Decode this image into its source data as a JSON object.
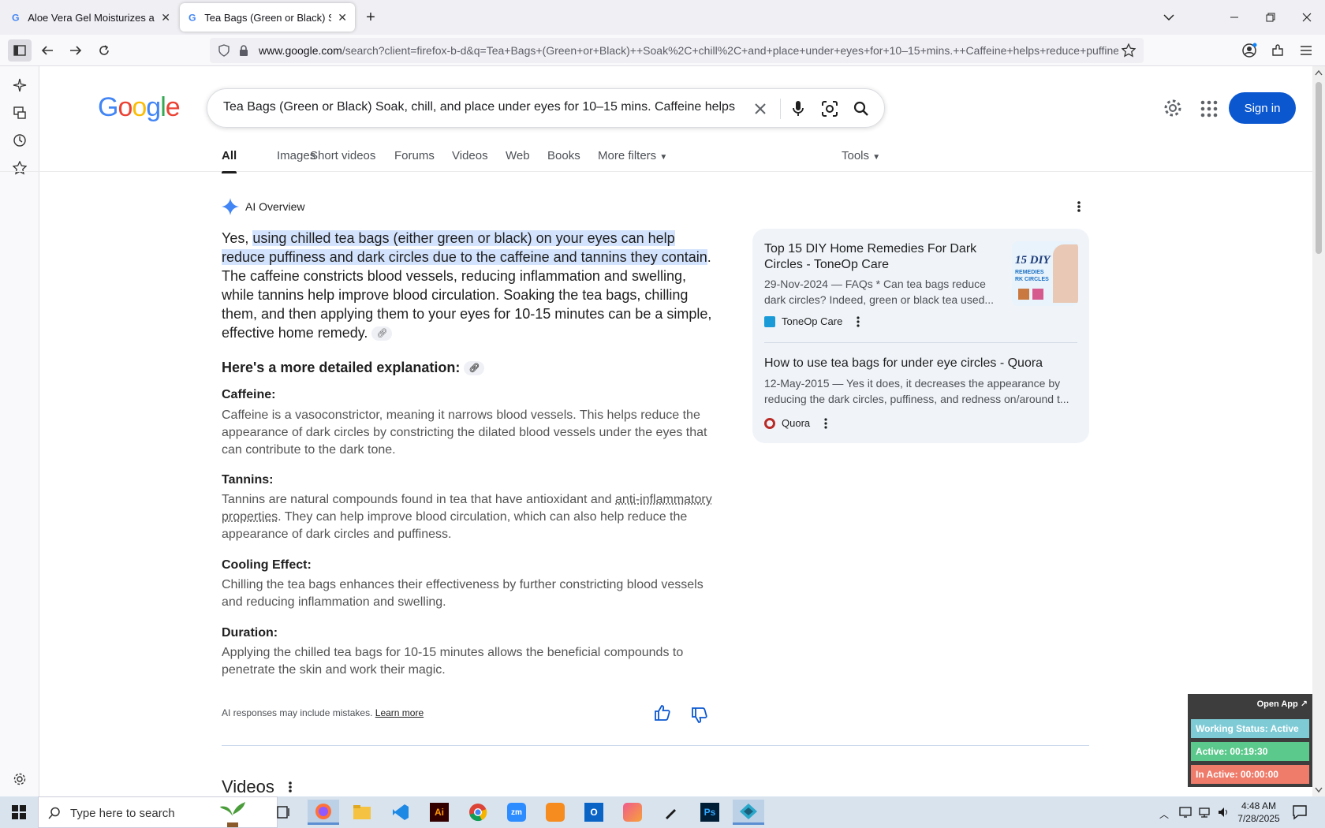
{
  "browser": {
    "tabs": [
      {
        "title": "Aloe Vera Gel Moisturizes and s",
        "active": false
      },
      {
        "title": "Tea Bags (Green or Black) Soak,",
        "active": true
      }
    ],
    "url_domain": "www.google.com",
    "url_rest": "/search?client=firefox-b-d&q=Tea+Bags+(Green+or+Black)++Soak%2C+chill%2C+and+place+under+eyes+for+10–15+mins.++Caffeine+helps+reduce+puffiness"
  },
  "google": {
    "logo": "Google",
    "query": "Tea Bags (Green or Black) Soak, chill, and place under eyes for 10–15 mins. Caffeine helps reduce puffiness",
    "signin_label": "Sign in",
    "filters": [
      "All",
      "Images",
      "Short videos",
      "Forums",
      "Videos",
      "Web",
      "Books",
      "More filters"
    ],
    "tools_label": "Tools"
  },
  "ai_overview": {
    "label": "AI Overview",
    "intro_prefix": "Yes, ",
    "intro_highlight": "using chilled tea bags (either green or black) on your eyes can help reduce puffiness and dark circles due to the caffeine and tannins they contain",
    "intro_rest": ". The caffeine constricts blood vessels, reducing inflammation and swelling, while tannins help improve blood circulation. Soaking the tea bags, chilling them, and then applying them to your eyes for 10-15 minutes can be a simple, effective home remedy.",
    "detail_heading": "Here's a more detailed explanation:",
    "sections": [
      {
        "title": "Caffeine:",
        "body": "Caffeine is a vasoconstrictor, meaning it narrows blood vessels. This helps reduce the appearance of dark circles by constricting the dilated blood vessels under the eyes that can contribute to the dark tone."
      },
      {
        "title": "Tannins:",
        "body_pre": "Tannins are natural compounds found in tea that have antioxidant and ",
        "body_link": "anti-inflammatory properties",
        "body_post": ". They can help improve blood circulation, which can also help reduce the appearance of dark circles and puffiness."
      },
      {
        "title": "Cooling Effect:",
        "body": "Chilling the tea bags enhances their effectiveness by further constricting blood vessels and reducing inflammation and swelling."
      },
      {
        "title": "Duration:",
        "body": "Applying the chilled tea bags for 10-15 minutes allows the beneficial compounds to penetrate the skin and work their magic."
      }
    ],
    "disclaimer": "AI responses may include mistakes.",
    "learn_more": "Learn more"
  },
  "sources": [
    {
      "title": "Top 15 DIY Home Remedies For Dark Circles - ToneOp Care",
      "snippet": "29-Nov-2024 — FAQs * Can tea bags reduce dark circles? Indeed, green or black tea used...",
      "site": "ToneOp Care",
      "thumb_text1": "15 DIY",
      "thumb_text2": "REMEDIES",
      "thumb_text3": "RK CIRCLES"
    },
    {
      "title": "How to use tea bags for under eye circles - Quora",
      "snippet": "12-May-2015 — Yes it does, it decreases the appearance by reducing the dark circles, puffiness, and redness on/around t...",
      "site": "Quora"
    }
  ],
  "videos_heading": "Videos",
  "widget": {
    "open_app": "Open App ↗",
    "status": "Working Status: Active",
    "active": "Active: 00:19:30",
    "inactive": "In Active: 00:00:00",
    "colors": {
      "status": "#7ecbd6",
      "active": "#5cc98c",
      "inactive": "#ef7b6a"
    }
  },
  "taskbar": {
    "search_placeholder": "Type here to search",
    "time": "4:48 AM",
    "date": "7/28/2025"
  }
}
